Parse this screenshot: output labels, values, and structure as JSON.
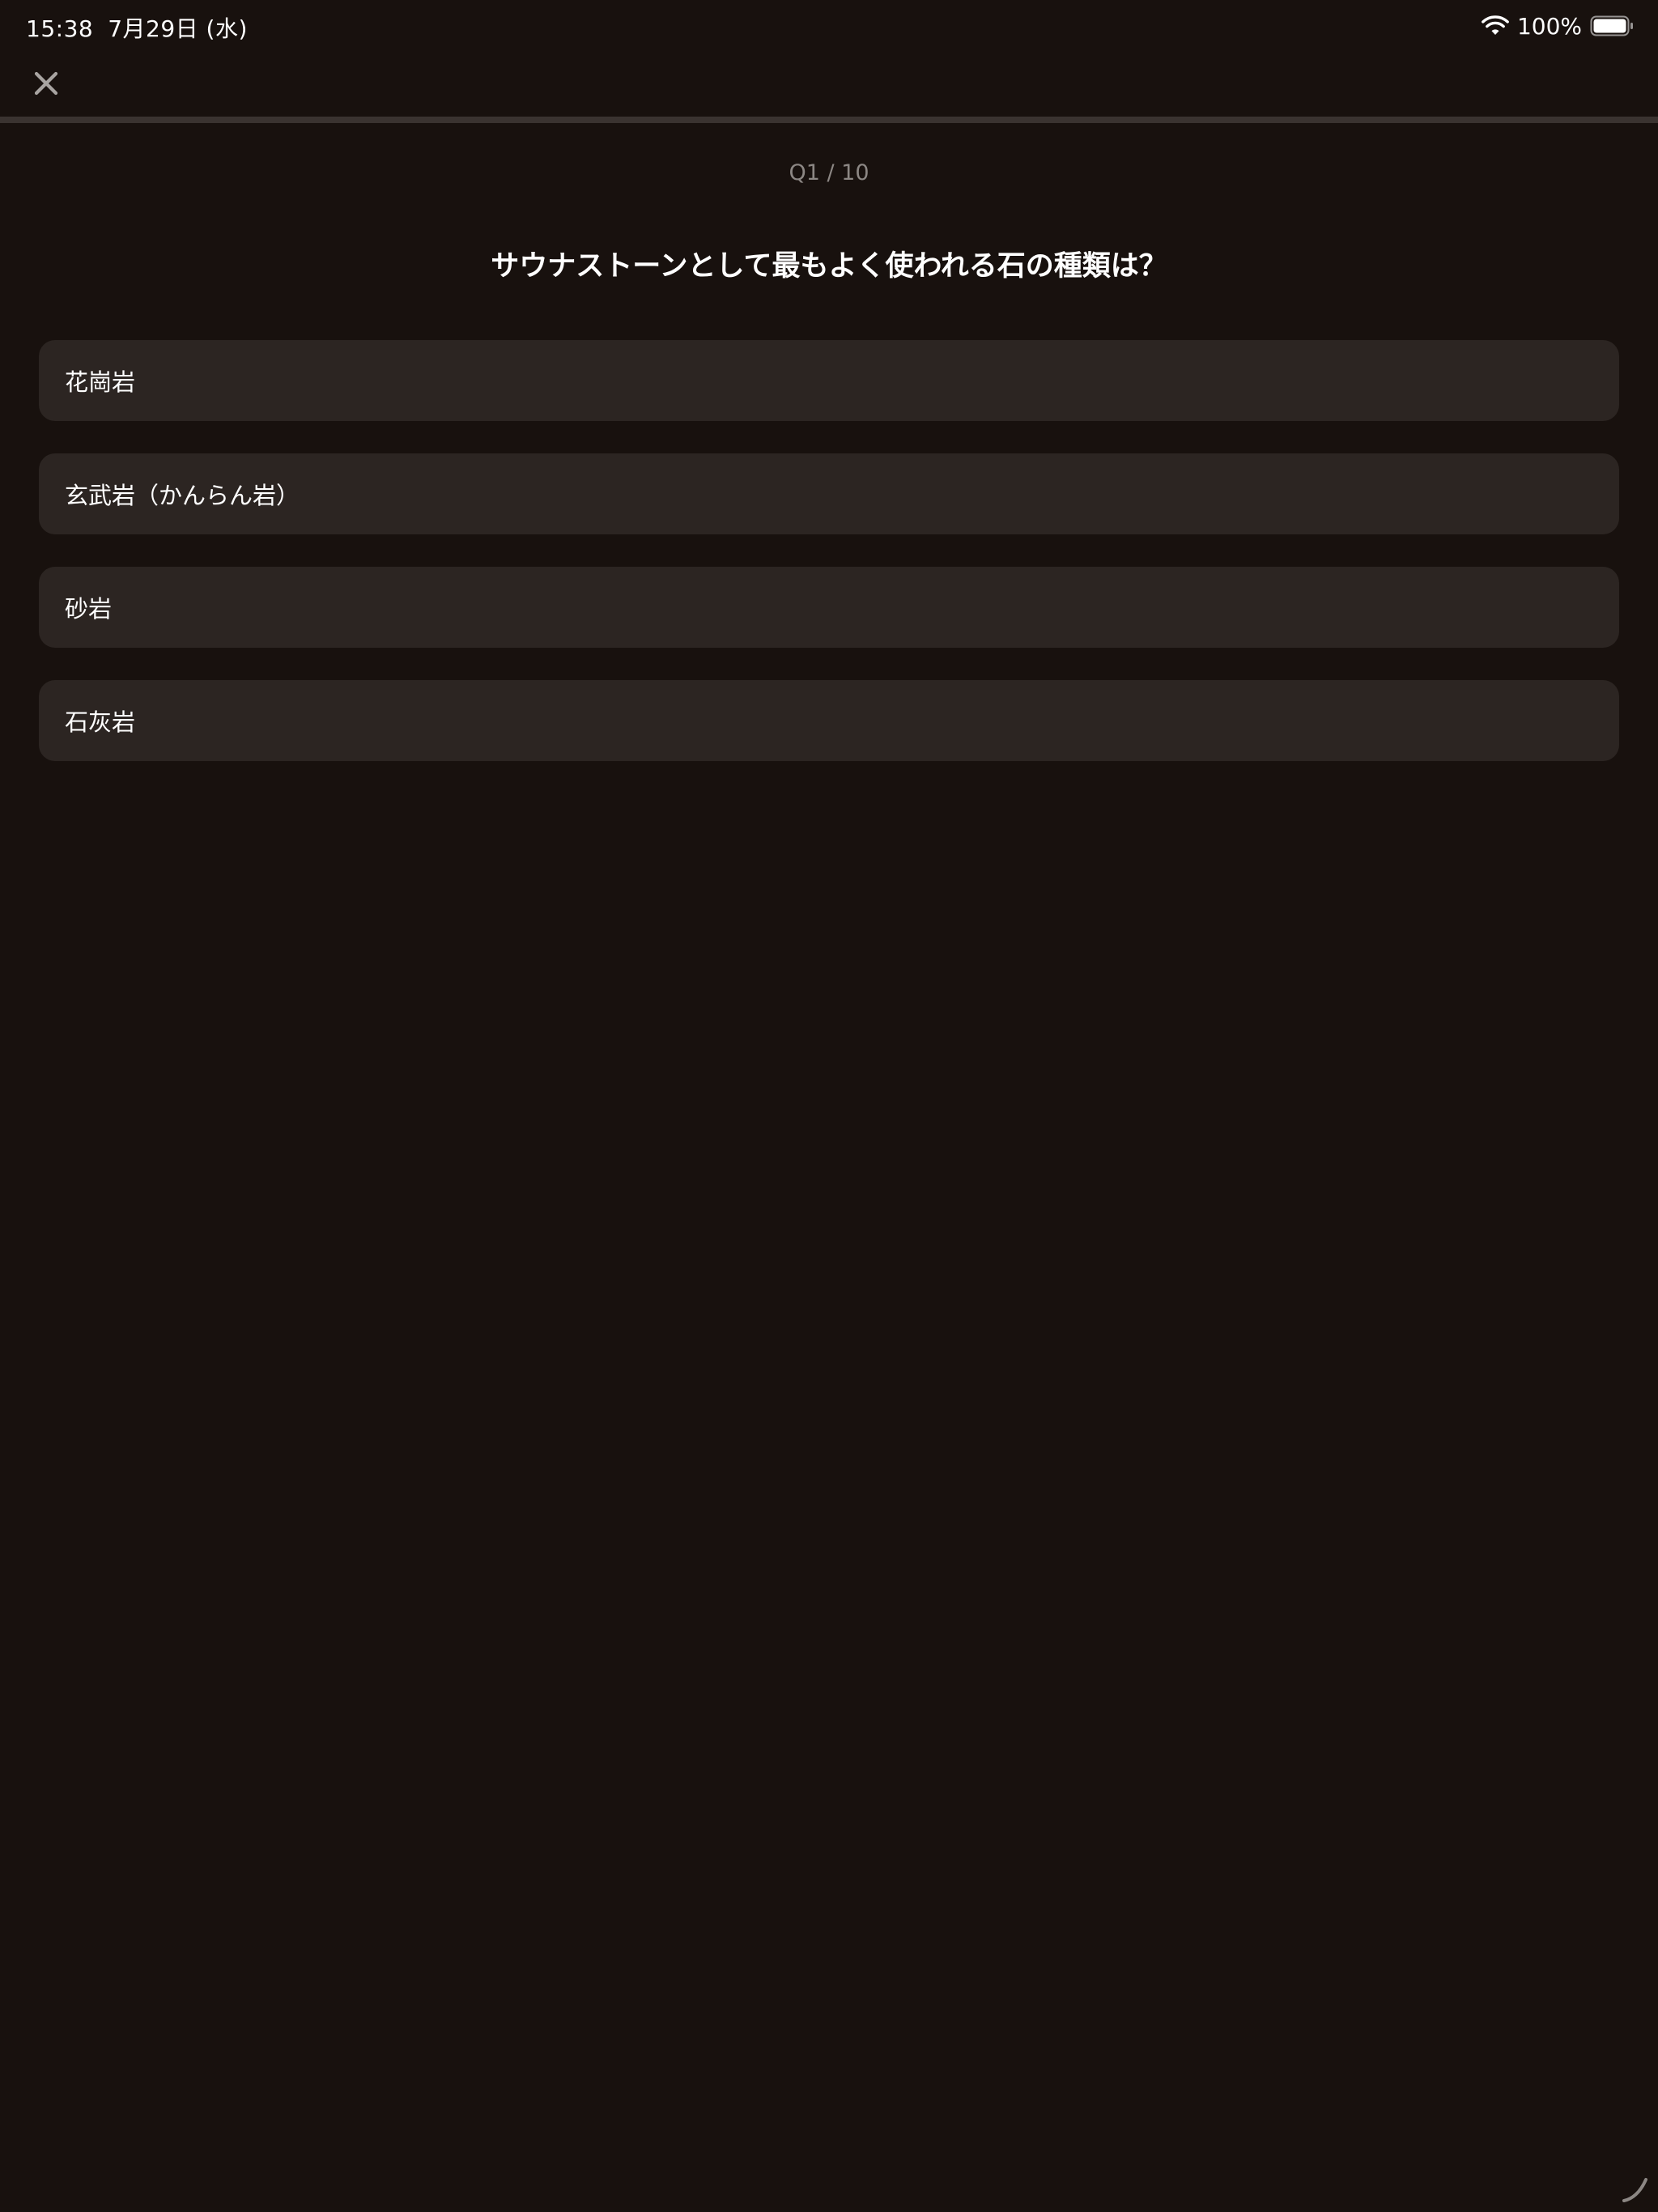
{
  "status_bar": {
    "time": "15:38",
    "date": "7月29日 (水)",
    "battery_percent": "100%",
    "icons": [
      "wifi-icon",
      "battery-icon"
    ]
  },
  "top_bar": {
    "close_icon": "close-icon"
  },
  "progress": {
    "current": 1,
    "total": 10,
    "fraction": 0.0
  },
  "quiz": {
    "counter": "Q1 / 10",
    "question": "サウナストーンとして最もよく使われる石の種類は？",
    "options": [
      {
        "label": "花崗岩"
      },
      {
        "label": "玄武岩（かんらん岩）"
      },
      {
        "label": "砂岩"
      },
      {
        "label": "石灰岩"
      }
    ]
  },
  "colors": {
    "background": "#18110e",
    "option_background": "#2c2522",
    "progress_track": "#3a3330",
    "counter_text": "#8c8784",
    "text": "#ffffff"
  }
}
